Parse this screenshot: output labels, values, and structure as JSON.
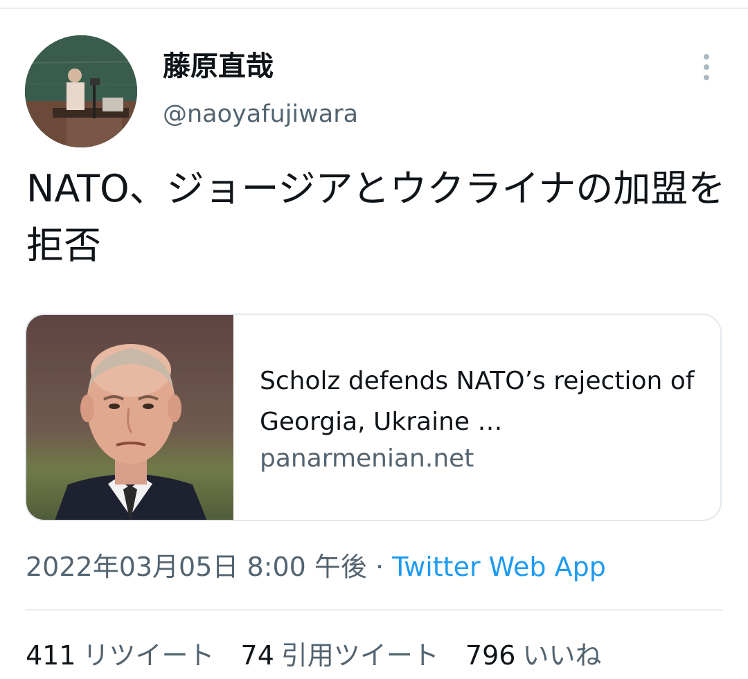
{
  "author": {
    "display_name": "藤原直哉",
    "handle": "@naoyafujiwara"
  },
  "tweet": {
    "text": "NATO、ジョージアとウクライナの加盟を拒否"
  },
  "link_card": {
    "title": "Scholz defends NATO’s rejection of Georgia, Ukraine …",
    "domain": "panarmenian.net"
  },
  "meta": {
    "date": "2022年03月05日",
    "time": "8:00 午後",
    "separator": "·",
    "source": "Twitter Web App"
  },
  "stats": {
    "retweets": {
      "count": "411",
      "label": "リツイート"
    },
    "quotes": {
      "count": "74",
      "label": "引用ツイート"
    },
    "likes": {
      "count": "796",
      "label": "いいね"
    }
  },
  "colors": {
    "text_primary": "#0f1419",
    "text_secondary": "#536471",
    "link": "#1d9bf0",
    "border": "#e1e8ed"
  },
  "icons": {
    "more": "more-vertical-icon"
  }
}
